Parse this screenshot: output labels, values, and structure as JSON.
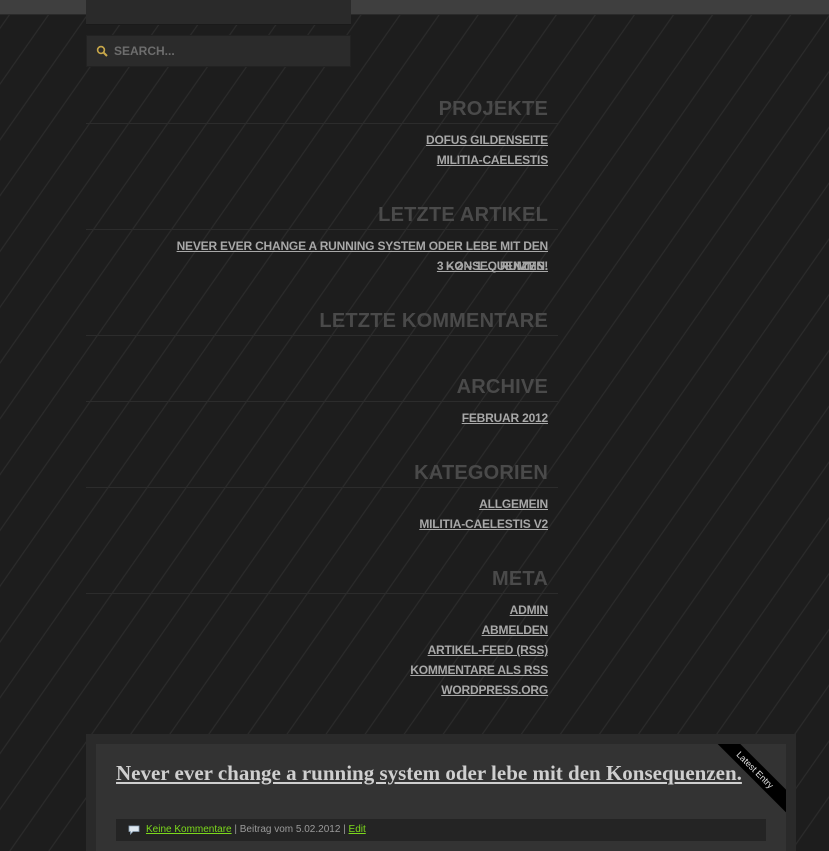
{
  "search": {
    "placeholder": "SEARCH...",
    "icon": "search-icon"
  },
  "sidebar": {
    "projekte": {
      "title": "PROJEKTE",
      "items": [
        "DOFUS GILDENSEITE",
        "MILITIA-CAELESTIS"
      ]
    },
    "letzte_artikel": {
      "title": "LETZTE ARTIKEL",
      "items": [
        "NEVER EVER CHANGE A RUNNING SYSTEM ODER LEBE MIT DEN KONSEQUENZEN.",
        "3 – 2 – 1 … RUMMS!"
      ]
    },
    "letzte_kommentare": {
      "title": "LETZTE KOMMENTARE"
    },
    "archive": {
      "title": "ARCHIVE",
      "items": [
        "FEBRUAR 2012"
      ]
    },
    "kategorien": {
      "title": "KATEGORIEN",
      "items": [
        "ALLGEMEIN",
        "MILITIA-CAELESTIS V2"
      ]
    },
    "meta": {
      "title": "META",
      "items": [
        "ADMIN",
        "ABMELDEN",
        "ARTIKEL-FEED (RSS)",
        "KOMMENTARE ALS RSS",
        "WORDPRESS.ORG"
      ]
    }
  },
  "post": {
    "title": "Never ever change a running system oder lebe mit den Konsequenzen.",
    "ribbon": "Latest Entry",
    "comments_link": "Keine Kommentare",
    "meta_text": " | Beitrag vom 5.02.2012 | ",
    "edit_link": "Edit"
  },
  "colors": {
    "background": "#1d1d1d",
    "heading": "#4a4a4a",
    "link": "#a8a8a8",
    "accent_green": "#7cd91c"
  }
}
